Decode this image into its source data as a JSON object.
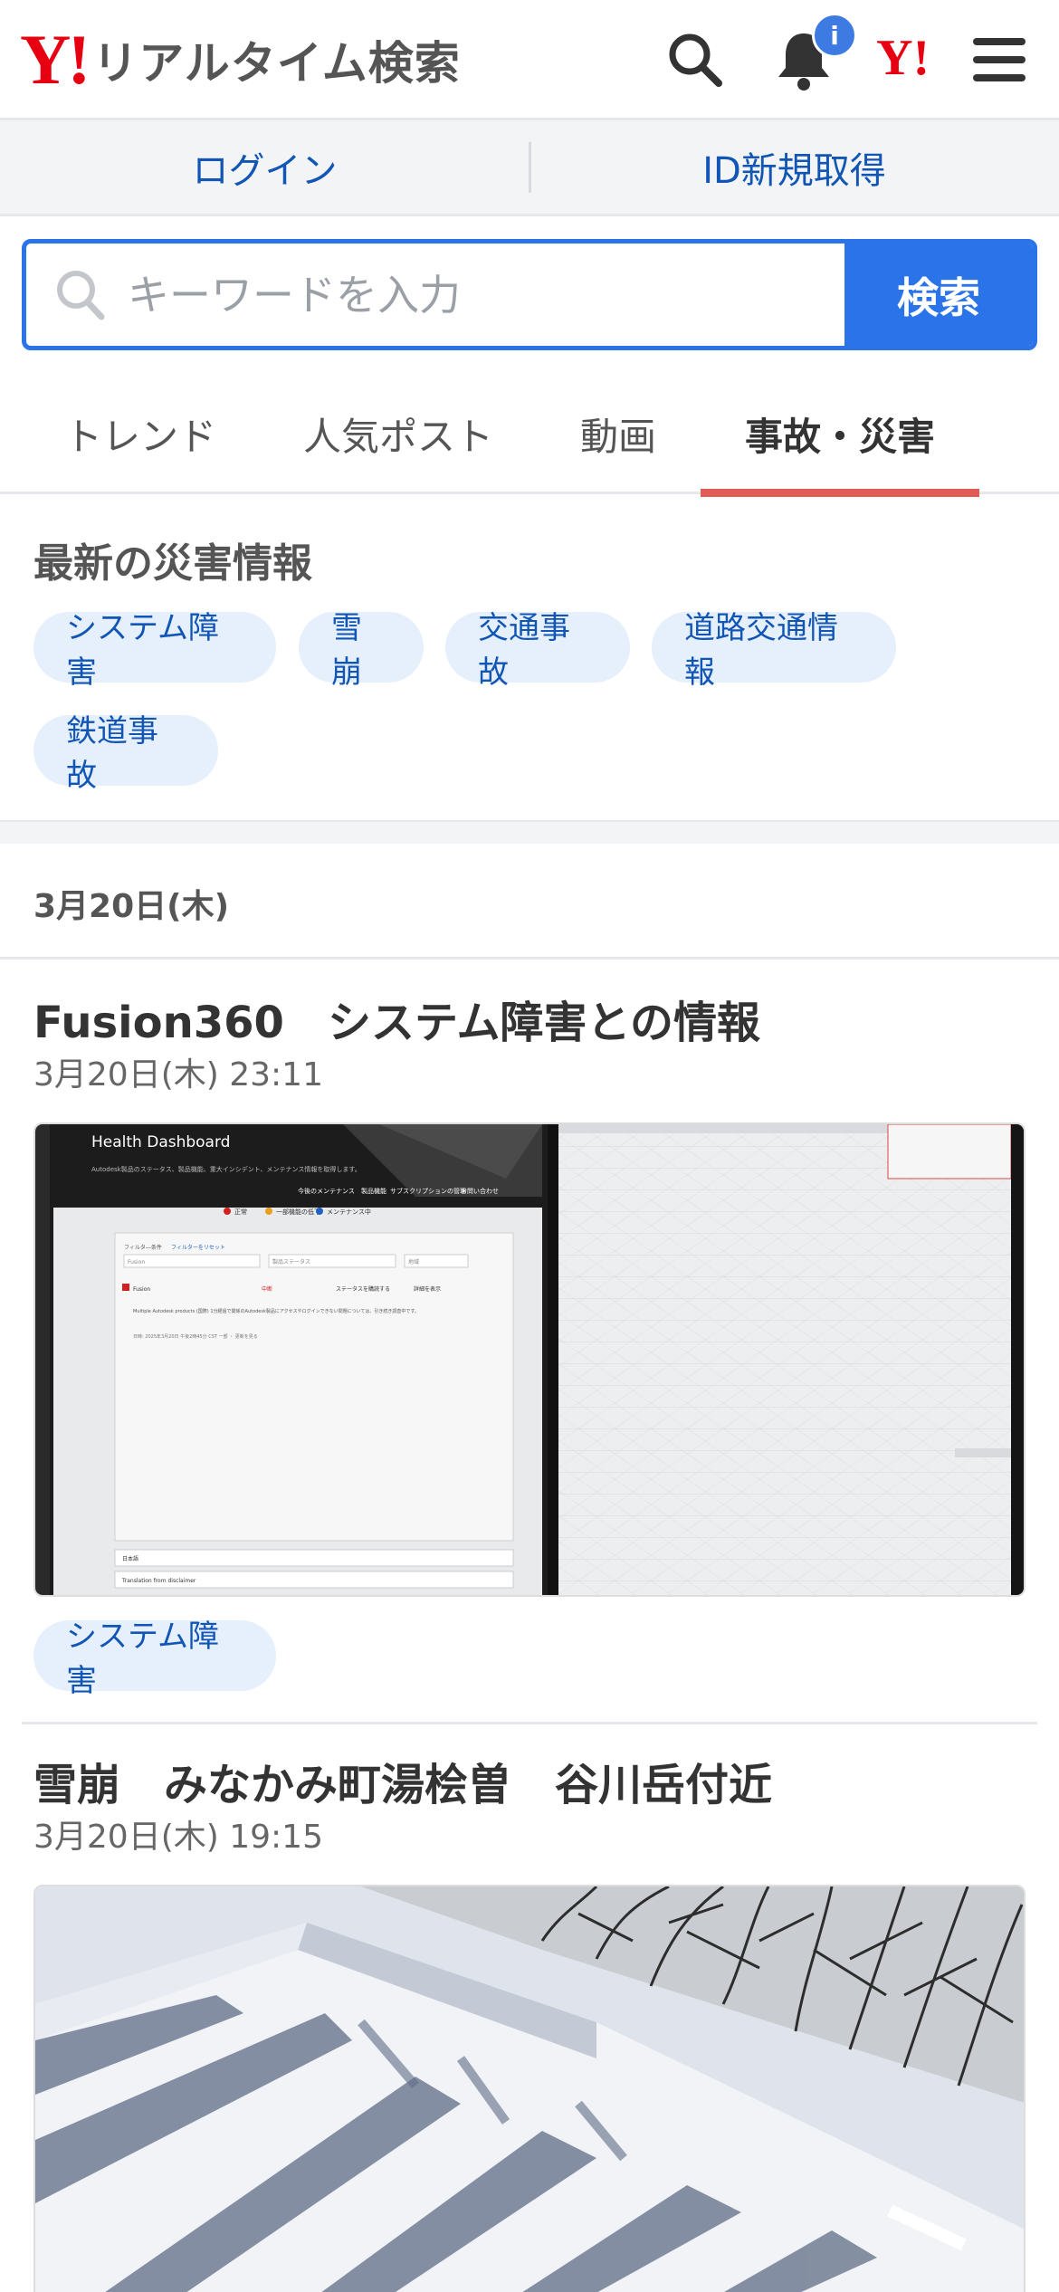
{
  "header": {
    "logo_mark": "Y!",
    "logo_text": "リアルタイム検索",
    "notification_badge": "i",
    "yahoo_small_logo": "Y!"
  },
  "auth": {
    "login": "ログイン",
    "register": "ID新規取得"
  },
  "search": {
    "placeholder": "キーワードを入力",
    "button": "検索"
  },
  "tabs": [
    {
      "label": "トレンド"
    },
    {
      "label": "人気ポスト"
    },
    {
      "label": "動画"
    },
    {
      "label": "事故・災害"
    }
  ],
  "disaster": {
    "title": "最新の災害情報",
    "chips": [
      "システム障害",
      "雪崩",
      "交通事故",
      "道路交通情報",
      "鉄道事故"
    ]
  },
  "date_header": "3月20日(木)",
  "posts": [
    {
      "title": "Fusion360　システム障害との情報",
      "time": "3月20日(木) 23:11",
      "image_texts": {
        "heading": "Health Dashboard",
        "sub": "Autodesk製品のステータス、製品機能、重大インシデント、メンテナンス情報を取得します。",
        "nav1": "今後のメンテナンス",
        "nav2": "製品機能",
        "nav3": "サブスクリプションの管理",
        "nav4": "お問い合わせ",
        "filter1": "正常",
        "filter2": "一部機能の低下",
        "filter3": "メンテナンス中",
        "filter_label": "フィルタ―条件",
        "filter_link": "フィルターをリセット",
        "field1": "Fusion",
        "field2": "製品ステータス",
        "field3": "地域",
        "row_product": "Fusion",
        "row_status": "中断",
        "row_action": "ステータスを購読する",
        "row_detail": "詳細を表示",
        "row_body1": "Multiple Autodesk products (国際) 1分経過で関係のAutodesk製品にアクセスやログインできない問題については、引き続き調査中です。",
        "row_body2": "日時: 2025年3月20日 午後2時45分 CST 一部 ・ 更新を見る",
        "lang": "日本語",
        "translate": "Translation from disclaimer"
      },
      "tag": "システム障害"
    },
    {
      "title": "雪崩　みなかみ町湯桧曽　谷川岳付近",
      "time": "3月20日(木) 19:15"
    }
  ],
  "colors": {
    "brand_red": "#e60012",
    "accent_blue": "#2a73e8",
    "link_blue": "#1155b5",
    "tab_underline": "#e25a55",
    "chip_bg": "#e6effc"
  },
  "icons": [
    "search-icon",
    "bell-icon",
    "menu-icon"
  ]
}
